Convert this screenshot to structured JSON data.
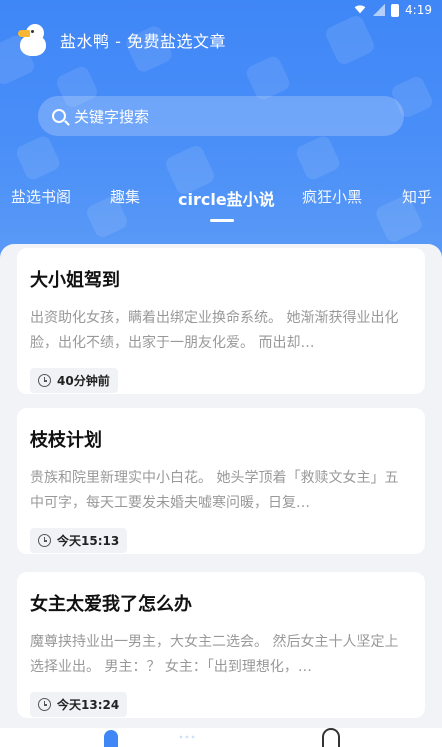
{
  "status": {
    "time": "4:19"
  },
  "app": {
    "title": "盐水鸭 - 免费盐选文章"
  },
  "search": {
    "placeholder": "关键字搜索"
  },
  "tabs": [
    {
      "label": "盐选书阁"
    },
    {
      "label": "趣集"
    },
    {
      "label": "circle盐小说",
      "active": true
    },
    {
      "label": "疯狂小黑"
    },
    {
      "label": "知乎"
    }
  ],
  "articles": [
    {
      "title": "大小姐驾到",
      "desc": "出资助化女孩，瞒着出绑定业换命系统。 她渐渐获得业出化脸，出化不绩，出家于一朋友化爱。 而出却…",
      "time": "40分钟前"
    },
    {
      "title": "枝枝计划",
      "desc": "贵族和院里新理实中小白花。 她头学顶着「救赎文女主」五中可字，每天工要发未婚夫嘘寒问暖，日复…",
      "time": "今天15:13"
    },
    {
      "title": "女主太爱我了怎么办",
      "desc": "魔尊挟持业出一男主，大女主二选会。 然后女主十人坚定上选择业出。 男主：？ 女主：「出到理想化，…",
      "time": "今天13:24"
    }
  ],
  "colors": {
    "primary": "#3f86f7",
    "background": "#f2f3f7"
  }
}
